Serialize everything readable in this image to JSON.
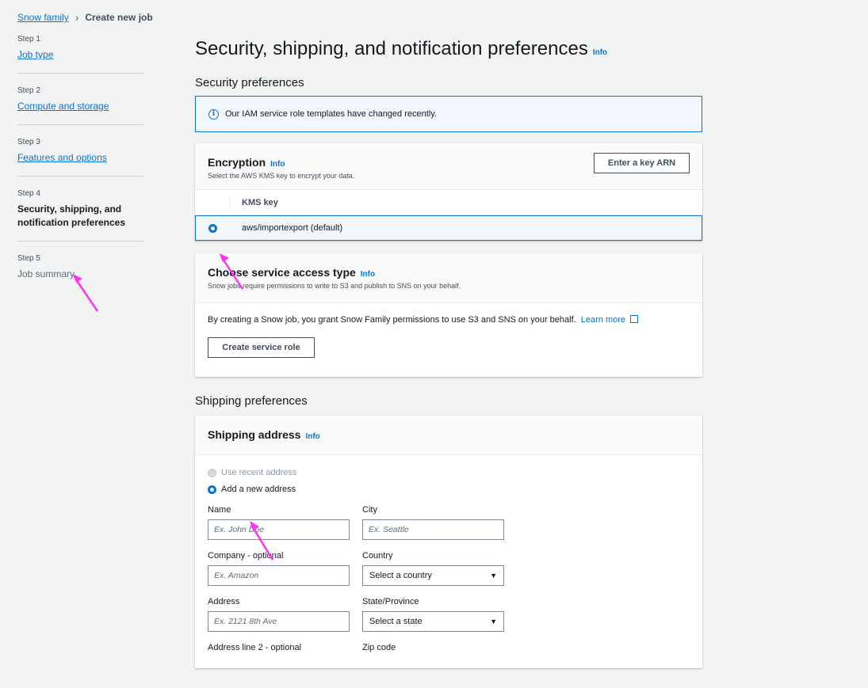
{
  "breadcrumb": {
    "root": "Snow family",
    "current": "Create new job"
  },
  "steps": [
    {
      "num": "Step 1",
      "label": "Job type",
      "state": "link"
    },
    {
      "num": "Step 2",
      "label": "Compute and storage",
      "state": "link"
    },
    {
      "num": "Step 3",
      "label": "Features and options",
      "state": "link"
    },
    {
      "num": "Step 4",
      "label": "Security, shipping, and notification preferences",
      "state": "current"
    },
    {
      "num": "Step 5",
      "label": "Job summary",
      "state": "disabled"
    }
  ],
  "page": {
    "title": "Security, shipping, and notification preferences",
    "info": "Info"
  },
  "security": {
    "heading": "Security preferences",
    "alert": "Our IAM service role templates have changed recently.",
    "encryption": {
      "title": "Encryption",
      "info": "Info",
      "description": "Select the AWS KMS key to encrypt your data.",
      "button": "Enter a key ARN",
      "column": "KMS key",
      "row": "aws/importexport (default)"
    },
    "access": {
      "title": "Choose service access type",
      "info": "Info",
      "description": "Snow jobs require permissions to write to S3 and publish to SNS on your behalf.",
      "body": "By creating a Snow job, you grant Snow Family permissions to use S3 and SNS on your behalf.",
      "learn_more": "Learn more",
      "button": "Create service role"
    }
  },
  "shipping": {
    "heading": "Shipping preferences",
    "address": {
      "title": "Shipping address",
      "info": "Info",
      "option_recent": "Use recent address",
      "option_new": "Add a new address",
      "name_label": "Name",
      "name_placeholder": "Ex. John Doe",
      "city_label": "City",
      "city_placeholder": "Ex. Seattle",
      "company_label": "Company - optional",
      "company_placeholder": "Ex. Amazon",
      "country_label": "Country",
      "country_value": "Select a country",
      "address_label": "Address",
      "address_placeholder": "Ex. 2121 8th Ave",
      "state_label": "State/Province",
      "state_value": "Select a state",
      "address2_label": "Address line 2 - optional",
      "zip_label": "Zip code"
    }
  },
  "colors": {
    "accent": "#0972d3",
    "annotation": "#ff33ee"
  }
}
